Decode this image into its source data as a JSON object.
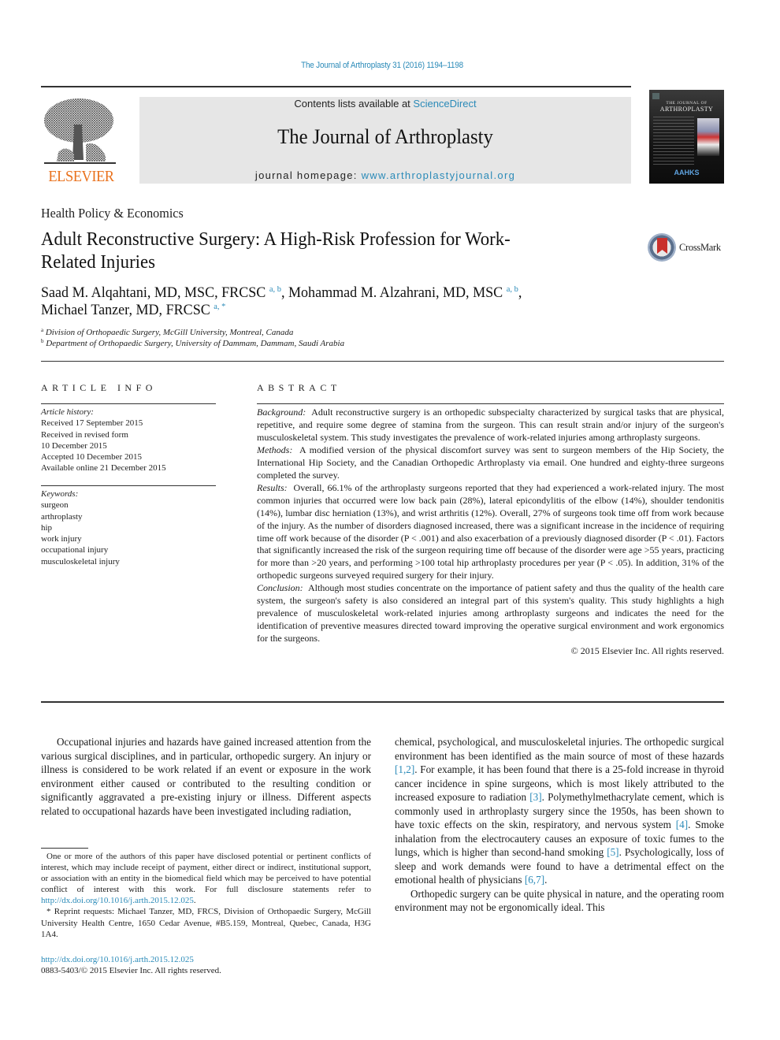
{
  "header": {
    "citation": "The Journal of Arthroplasty 31 (2016) 1194–1198",
    "publisher_logo_text": "ELSEVIER",
    "contents_prefix": "Contents lists available at ",
    "contents_link": "ScienceDirect",
    "journal_title": "The Journal of Arthroplasty",
    "homepage_prefix": "journal homepage: ",
    "homepage_link": "www.arthroplastyjournal.org",
    "cover": {
      "title_line1": "THE JOURNAL OF",
      "title_line2": "ARTHROPLASTY",
      "society": "AAHKS"
    },
    "colors": {
      "link": "#2a8ab8",
      "elsevier_orange": "#e9711c",
      "header_box": "#e6e6e6"
    }
  },
  "article": {
    "section": "Health Policy & Economics",
    "title": "Adult Reconstructive Surgery: A High-Risk Profession for Work-Related Injuries",
    "crossmark_label": "CrossMark",
    "authors": [
      {
        "name": "Saad M. Alqahtani, MD, MSC, FRCSC",
        "sup": "a, b",
        "sep": ", "
      },
      {
        "name": "Mohammad M. Alzahrani, MD, MSC",
        "sup": "a, b",
        "sep": ","
      },
      {
        "name": "Michael Tanzer, MD, FRCSC",
        "sup": "a, *",
        "sep": ""
      }
    ],
    "affiliations": [
      {
        "key": "a",
        "text": "Division of Orthopaedic Surgery, McGill University, Montreal, Canada"
      },
      {
        "key": "b",
        "text": "Department of Orthopaedic Surgery, University of Dammam, Dammam, Saudi Arabia"
      }
    ]
  },
  "article_info": {
    "heading": "ARTICLE INFO",
    "history_label": "Article history:",
    "history": [
      "Received 17 September 2015",
      "Received in revised form",
      "10 December 2015",
      "Accepted 10 December 2015",
      "Available online 21 December 2015"
    ],
    "keywords_label": "Keywords:",
    "keywords": [
      "surgeon",
      "arthroplasty",
      "hip",
      "work injury",
      "occupational injury",
      "musculoskeletal injury"
    ]
  },
  "abstract": {
    "heading": "ABSTRACT",
    "sections": [
      {
        "label": "Background:",
        "text": "Adult reconstructive surgery is an orthopedic subspecialty characterized by surgical tasks that are physical, repetitive, and require some degree of stamina from the surgeon. This can result strain and/or injury of the surgeon's musculoskeletal system. This study investigates the prevalence of work-related injuries among arthroplasty surgeons."
      },
      {
        "label": "Methods:",
        "text": "A modified version of the physical discomfort survey was sent to surgeon members of the Hip Society, the International Hip Society, and the Canadian Orthopedic Arthroplasty via email. One hundred and eighty-three surgeons completed the survey."
      },
      {
        "label": "Results:",
        "text": "Overall, 66.1% of the arthroplasty surgeons reported that they had experienced a work-related injury. The most common injuries that occurred were low back pain (28%), lateral epicondylitis of the elbow (14%), shoulder tendonitis (14%), lumbar disc herniation (13%), and wrist arthritis (12%). Overall, 27% of surgeons took time off from work because of the injury. As the number of disorders diagnosed increased, there was a significant increase in the incidence of requiring time off work because of the disorder (P < .001) and also exacerbation of a previously diagnosed disorder (P < .01). Factors that significantly increased the risk of the surgeon requiring time off because of the disorder were age >55 years, practicing for more than >20 years, and performing >100 total hip arthroplasty procedures per year (P < .05). In addition, 31% of the orthopedic surgeons surveyed required surgery for their injury."
      },
      {
        "label": "Conclusion:",
        "text": "Although most studies concentrate on the importance of patient safety and thus the quality of the health care system, the surgeon's safety is also considered an integral part of this system's quality. This study highlights a high prevalence of musculoskeletal work-related injuries among arthroplasty surgeons and indicates the need for the identification of preventive measures directed toward improving the operative surgical environment and work ergonomics for the surgeons."
      }
    ],
    "copyright": "© 2015 Elsevier Inc. All rights reserved."
  },
  "body": {
    "left_paragraph": "Occupational injuries and hazards have gained increased attention from the various surgical disciplines, and in particular, orthopedic surgery. An injury or illness is considered to be work related if an event or exposure in the work environment either caused or contributed to the resulting condition or significantly aggravated a pre-existing injury or illness. Different aspects related to occupational hazards have been investigated including radiation,",
    "right_segments": [
      {
        "t": "chemical, psychological, and musculoskeletal injuries. The orthopedic surgical environment has been identified as the main source of most of these hazards "
      },
      {
        "ref": "[1,2]"
      },
      {
        "t": ". For example, it has been found that there is a 25-fold increase in thyroid cancer incidence in spine surgeons, which is most likely attributed to the increased exposure to radiation "
      },
      {
        "ref": "[3]"
      },
      {
        "t": ". Polymethylmethacrylate cement, which is commonly used in arthroplasty surgery since the 1950s, has been shown to have toxic effects on the skin, respiratory, and nervous system "
      },
      {
        "ref": "[4]"
      },
      {
        "t": ". Smoke inhalation from the electrocautery causes an exposure of toxic fumes to the lungs, which is higher than second-hand smoking "
      },
      {
        "ref": "[5]"
      },
      {
        "t": ". Psychologically, loss of sleep and work demands were found to have a detrimental effect on the emotional health of physicians "
      },
      {
        "ref": "[6,7]"
      },
      {
        "t": "."
      }
    ],
    "right_paragraph2": "Orthopedic surgery can be quite physical in nature, and the operating room environment may not be ergonomically ideal. This"
  },
  "footnotes": {
    "disclosure_text": "One or more of the authors of this paper have disclosed potential or pertinent conflicts of interest, which may include receipt of payment, either direct or indirect, institutional support, or association with an entity in the biomedical field which may be perceived to have potential conflict of interest with this work. For full disclosure statements refer to ",
    "disclosure_link": "http://dx.doi.org/10.1016/j.arth.2015.12.025",
    "disclosure_end": ".",
    "reprint": "* Reprint requests: Michael Tanzer, MD, FRCS, Division of Orthopaedic Surgery, McGill University Health Centre, 1650 Cedar Avenue, #B5.159, Montreal, Quebec, Canada, H3G 1A4."
  },
  "bottom": {
    "doi_link": "http://dx.doi.org/10.1016/j.arth.2015.12.025",
    "issn_line": "0883-5403/© 2015 Elsevier Inc. All rights reserved."
  }
}
